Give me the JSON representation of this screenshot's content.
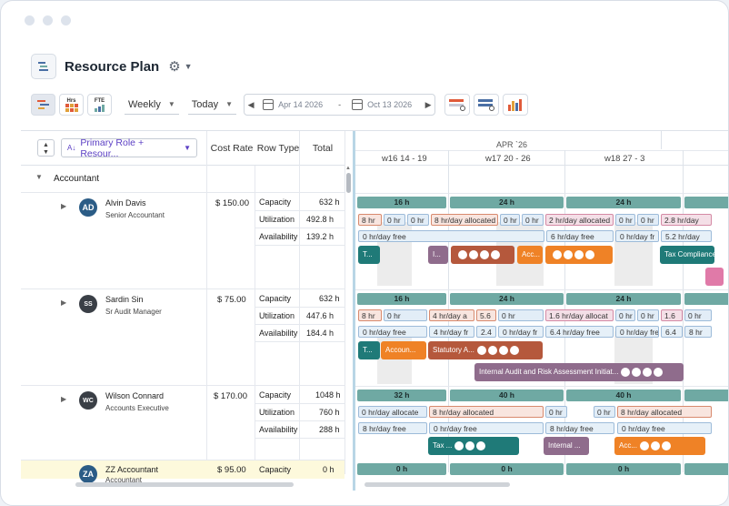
{
  "header": {
    "title": "Resource Plan"
  },
  "toolbar": {
    "hrs_label": "Hrs",
    "fte_label": "FTE",
    "view_select": "Weekly",
    "today_select": "Today",
    "date_start": "Apr 14 2026",
    "date_sep": "-",
    "date_end": "Oct 13 2026"
  },
  "columns": {
    "primary": "Primary Role + Resour...",
    "cost_rate": "Cost Rate",
    "row_type": "Row Type",
    "total": "Total"
  },
  "group": {
    "name": "Accountant"
  },
  "timeline": {
    "month": "APR `26",
    "weeks": [
      "w16  14 - 19",
      "w17  20 - 26",
      "w18  27 - 3"
    ]
  },
  "resources": [
    {
      "initials": "AD",
      "name": "Alvin Davis",
      "title": "Senior Accountant",
      "rate": "$ 150.00",
      "rows": [
        {
          "type": "Capacity",
          "total": "632 h"
        },
        {
          "type": "Utilization",
          "total": "492.8 h"
        },
        {
          "type": "Availability",
          "total": "139.2 h"
        }
      ],
      "cap": [
        "16 h",
        "24 h",
        "24 h"
      ],
      "util": [
        "8 hr",
        "0 hr",
        "0 hr",
        "8 hr/day allocated",
        "0 hr",
        "0 hr",
        "2 hr/day allocated",
        "0 hr",
        "0 hr",
        "2.8 hr/day"
      ],
      "avail": [
        "0 hr/day free",
        "6 hr/day free",
        "0 hr/day fr",
        "5.2 hr/day"
      ],
      "tasks": [
        "T...",
        "I...",
        "Acc...",
        "Tax Compliance"
      ]
    },
    {
      "initials": "SS",
      "name": "Sardin Sin",
      "title": "Sr Audit Manager",
      "rate": "$ 75.00",
      "rows": [
        {
          "type": "Capacity",
          "total": "632 h"
        },
        {
          "type": "Utilization",
          "total": "447.6 h"
        },
        {
          "type": "Availability",
          "total": "184.4 h"
        }
      ],
      "cap": [
        "16 h",
        "24 h",
        "24 h"
      ],
      "util": [
        "8 hr",
        "0 hr",
        "4 hr/day a",
        "5.6",
        "0 hr",
        "1.6 hr/day allocat",
        "0 hr",
        "0 hr",
        "1.6",
        "0 hr"
      ],
      "avail": [
        "0 hr/day free",
        "4 hr/day fr",
        "2.4",
        "0 hr/day fr",
        "6.4 hr/day free",
        "0 hr/day free",
        "6.4",
        "8 hr"
      ],
      "tasks": [
        "T...",
        "Accoun...",
        "Statutory A...",
        "Internal Audit and Risk Assessment Initiat..."
      ]
    },
    {
      "initials": "WC",
      "name": "Wilson Connard",
      "title": "Accounts Executive",
      "rate": "$ 170.00",
      "rows": [
        {
          "type": "Capacity",
          "total": "1048 h"
        },
        {
          "type": "Utilization",
          "total": "760 h"
        },
        {
          "type": "Availability",
          "total": "288 h"
        }
      ],
      "cap": [
        "32 h",
        "40 h",
        "40 h"
      ],
      "util": [
        "0 hr/day allocate",
        "8 hr/day allocated",
        "0 hr",
        "0 hr",
        "8 hr/day allocated"
      ],
      "avail": [
        "8 hr/day free",
        "0 hr/day free",
        "8 hr/day free",
        "0 hr/day free"
      ],
      "tasks": [
        "Tax ...",
        "Internal ...",
        "Acc..."
      ]
    },
    {
      "initials": "ZA",
      "name": "ZZ Accountant",
      "title": "Accountant",
      "rate": "$ 95.00",
      "rows": [
        {
          "type": "Capacity",
          "total": "0 h"
        }
      ],
      "cap": [
        "0 h",
        "0 h",
        "0 h"
      ]
    }
  ],
  "colors": {
    "capacity": "#6fa9a3",
    "teal_task": "#1f7a78",
    "orange_task": "#ef8226",
    "brown_task": "#b5583c",
    "purple_task": "#8f6c8c",
    "accent": "#5b3fc4"
  }
}
